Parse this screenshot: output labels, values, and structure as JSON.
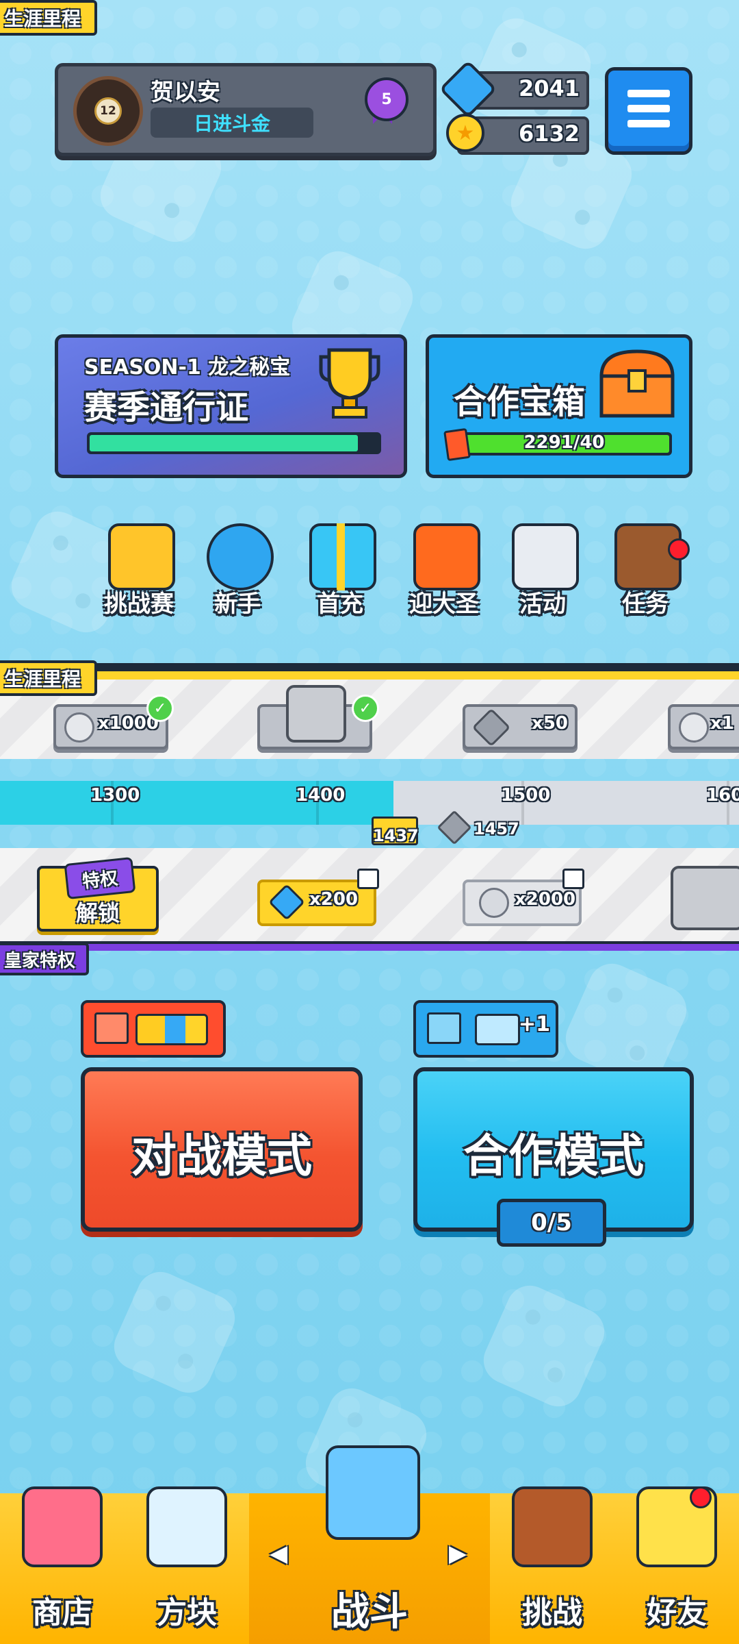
{
  "profile": {
    "name": "贺以安",
    "title": "日进斗金",
    "level": "12",
    "medal": "5"
  },
  "currency": {
    "gems": "2041",
    "coins": "6132"
  },
  "season": {
    "season_label": "SEASON-1 龙之秘宝",
    "title": "赛季通行证",
    "progress": 0.93
  },
  "coop_chest": {
    "title": "合作宝箱",
    "progress_text": "2291/40",
    "progress": 1.0
  },
  "shortcuts": [
    {
      "label": "挑战赛",
      "icon": "trophy-blocks-icon"
    },
    {
      "label": "新手",
      "icon": "stopwatch-icon"
    },
    {
      "label": "首充",
      "icon": "gift-box-icon"
    },
    {
      "label": "迎大圣",
      "icon": "flame-lantern-icon"
    },
    {
      "label": "活动",
      "icon": "notice-board-icon"
    },
    {
      "label": "任务",
      "icon": "quest-book-icon",
      "badge": true
    }
  ],
  "career": {
    "label": "生涯里程",
    "rewards_top": [
      "x1000",
      "",
      "x50",
      "x1"
    ],
    "track_marks": [
      "1300",
      "1400",
      "1500",
      "160"
    ],
    "current_score": "1437",
    "next_score": "1457",
    "rewards_bottom": [
      "解锁",
      "x200",
      "x2000"
    ],
    "unlock_badge": "特权"
  },
  "royal": {
    "label": "皇家特权"
  },
  "modes": {
    "battle": {
      "label": "对战模式"
    },
    "coop": {
      "label": "合作模式",
      "progress": "0/5",
      "bonus": "+1"
    }
  },
  "nav": {
    "items": [
      {
        "label": "商店",
        "icon": "shop-stall-icon"
      },
      {
        "label": "方块",
        "icon": "mystery-cube-icon"
      },
      {
        "label": "战斗",
        "icon": "sword-shield-icon"
      },
      {
        "label": "挑战",
        "icon": "challenge-board-icon"
      },
      {
        "label": "好友",
        "icon": "friend-character-icon",
        "badge": true
      }
    ]
  },
  "colors": {
    "accent_blue": "#1f8cf0",
    "battle_red": "#f45430",
    "coop_cyan": "#22bdf0",
    "nav_yellow": "#ffc21a"
  }
}
